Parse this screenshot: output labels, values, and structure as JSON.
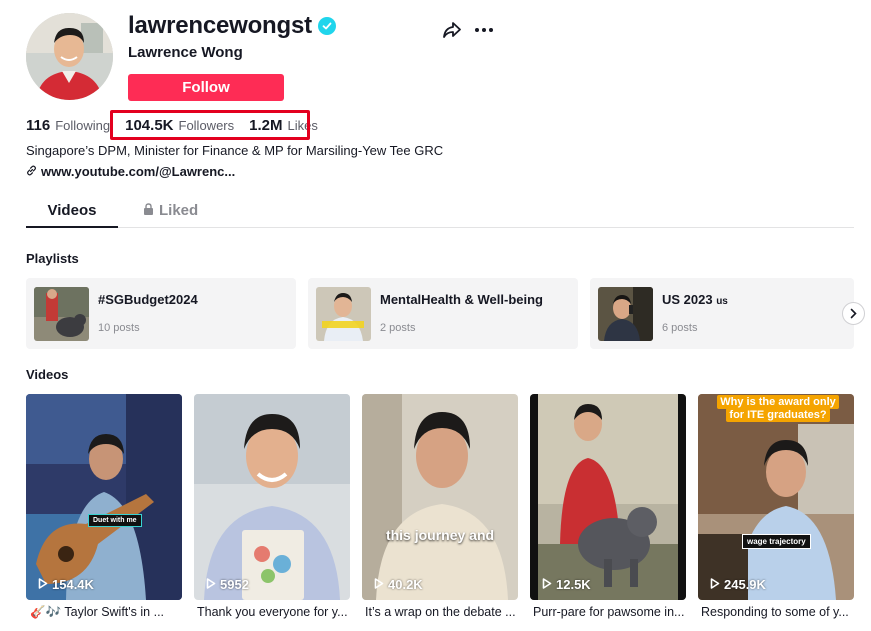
{
  "profile": {
    "username": "lawrencewongst",
    "display_name": "Lawrence Wong",
    "follow_label": "Follow",
    "following_count": "116",
    "following_label": "Following",
    "followers_count": "104.5K",
    "followers_label": "Followers",
    "likes_count": "1.2M",
    "likes_label": "Likes",
    "bio": "Singapore’s DPM, Minister for Finance & MP for Marsiling-Yew Tee GRC",
    "link": "www.youtube.com/@Lawrenc..."
  },
  "tabs": [
    {
      "label": "Videos",
      "active": true
    },
    {
      "label": "Liked",
      "active": false
    }
  ],
  "playlists_title": "Playlists",
  "playlists": [
    {
      "name": "#SGBudget2024",
      "suffix": "",
      "count": "10 posts"
    },
    {
      "name": "MentalHealth & Well-being",
      "suffix": "",
      "count": "2 posts"
    },
    {
      "name": "US 2023 ",
      "suffix": "us",
      "count": "6 posts"
    }
  ],
  "videos_title": "Videos",
  "videos": [
    {
      "views": "154.4K",
      "caption": "🎸🎶 Taylor Swift's in ...",
      "overlay": "Duet with me"
    },
    {
      "views": "5952",
      "caption": "Thank you everyone for y...",
      "overlay": ""
    },
    {
      "views": "40.2K",
      "caption": "It’s a wrap on the debate ...",
      "overlay": "this journey and"
    },
    {
      "views": "12.5K",
      "caption": "Purr-pare for pawsome in...",
      "overlay": ""
    },
    {
      "views": "245.9K",
      "caption": "Responding to some of y...",
      "overlay": "wage trajectory",
      "title_line1": "Why is the award only",
      "title_line2": "for ITE graduates?"
    }
  ],
  "colors": {
    "accent": "#fe2c55",
    "verified": "#20d5ec",
    "highlight_box": "#e3001f"
  },
  "icons": [
    "verified-badge-icon",
    "share-icon",
    "more-icon",
    "link-icon",
    "lock-icon",
    "chevron-right-icon",
    "play-icon"
  ]
}
